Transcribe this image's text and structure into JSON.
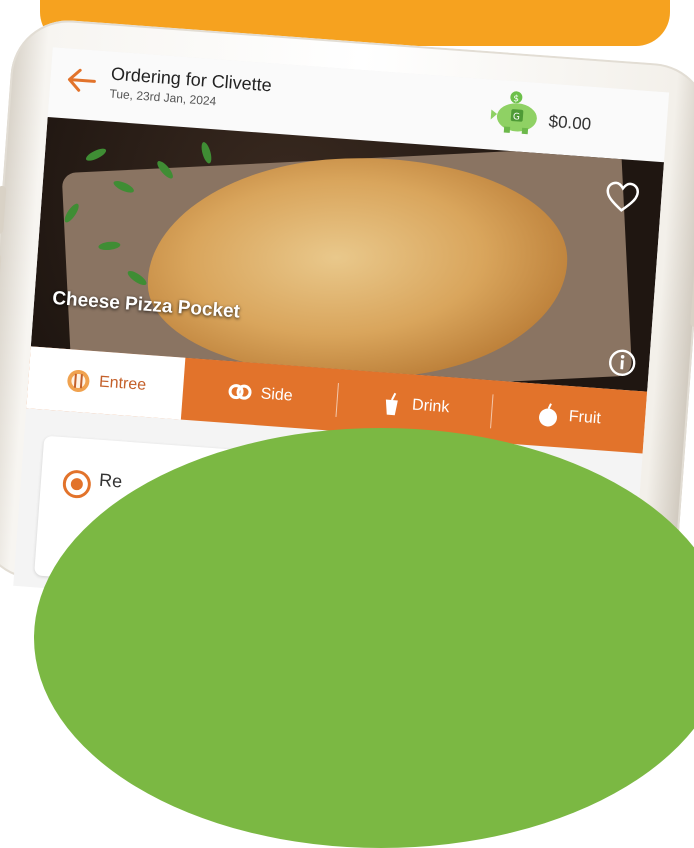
{
  "header": {
    "title": "Ordering for Clivette",
    "date": "Tue, 23rd Jan, 2024",
    "balance": "$0.00"
  },
  "hero": {
    "item_name": "Cheese Pizza Pocket"
  },
  "tabs": [
    {
      "label": "Entree",
      "icon": "utensils-plate-icon",
      "active": true
    },
    {
      "label": "Side",
      "icon": "pretzel-icon",
      "active": false
    },
    {
      "label": "Drink",
      "icon": "cup-icon",
      "active": false
    },
    {
      "label": "Fruit",
      "icon": "apple-icon",
      "active": false
    }
  ],
  "option": {
    "label": "Re",
    "selected": true
  },
  "colors": {
    "accent": "#e2732b",
    "banner": "#f6a21f",
    "overlay_green": "#7bb843"
  }
}
